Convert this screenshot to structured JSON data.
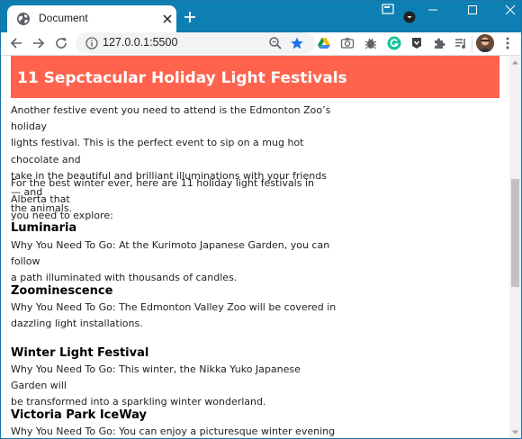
{
  "browser": {
    "tab_title": "Document",
    "url": "127.0.0.1:5500"
  },
  "page": {
    "heading": "11 Sepctacular Holiday Light Festivals",
    "intro_lines": [
      "Another festive event you need to attend is the Edmonton Zoo’s holiday",
      "lights festival. This is the perfect event to sip on a mug hot chocolate and",
      "take in the beautiful and brilliant illuminations with your friends — and",
      "the animals."
    ],
    "lead_lines": [
      "For the best winter ever, here are 11 holiday light festivals in Alberta that",
      "you need to explore:"
    ],
    "festivals": [
      {
        "name": "Luminaria",
        "lines": [
          "Why You Need To Go: At the Kurimoto Japanese Garden, you can follow",
          "a path illuminated with thousands of candles."
        ]
      },
      {
        "name": "Zoominescence",
        "lines": [
          "Why You Need To Go: The Edmonton Valley Zoo will be covered in",
          "dazzling light installations."
        ]
      },
      {
        "name": "Winter Light Festival",
        "lines": [
          "Why You Need To Go: This winter, the Nikka Yuko Japanese Garden will",
          "be transformed into a sparkling winter wonderland."
        ]
      },
      {
        "name": "Victoria Park IceWay",
        "lines": [
          "Why You Need To Go: You can enjoy a picturesque winter evening as you"
        ]
      }
    ]
  },
  "colors": {
    "titlebar": "#0e7fb2",
    "banner": "#ff634d",
    "bookmark_star": "#1a73e8"
  },
  "icons": {
    "tab": "globe-icon",
    "toolbar": [
      "back-arrow-icon",
      "forward-arrow-icon",
      "reload-icon",
      "info-icon",
      "zoom-icon",
      "bookmark-star-icon"
    ],
    "extensions": [
      "drive-icon",
      "camera-icon",
      "bug-icon",
      "grammarly-icon",
      "extension-icon",
      "puzzle-icon",
      "media-icon"
    ]
  }
}
